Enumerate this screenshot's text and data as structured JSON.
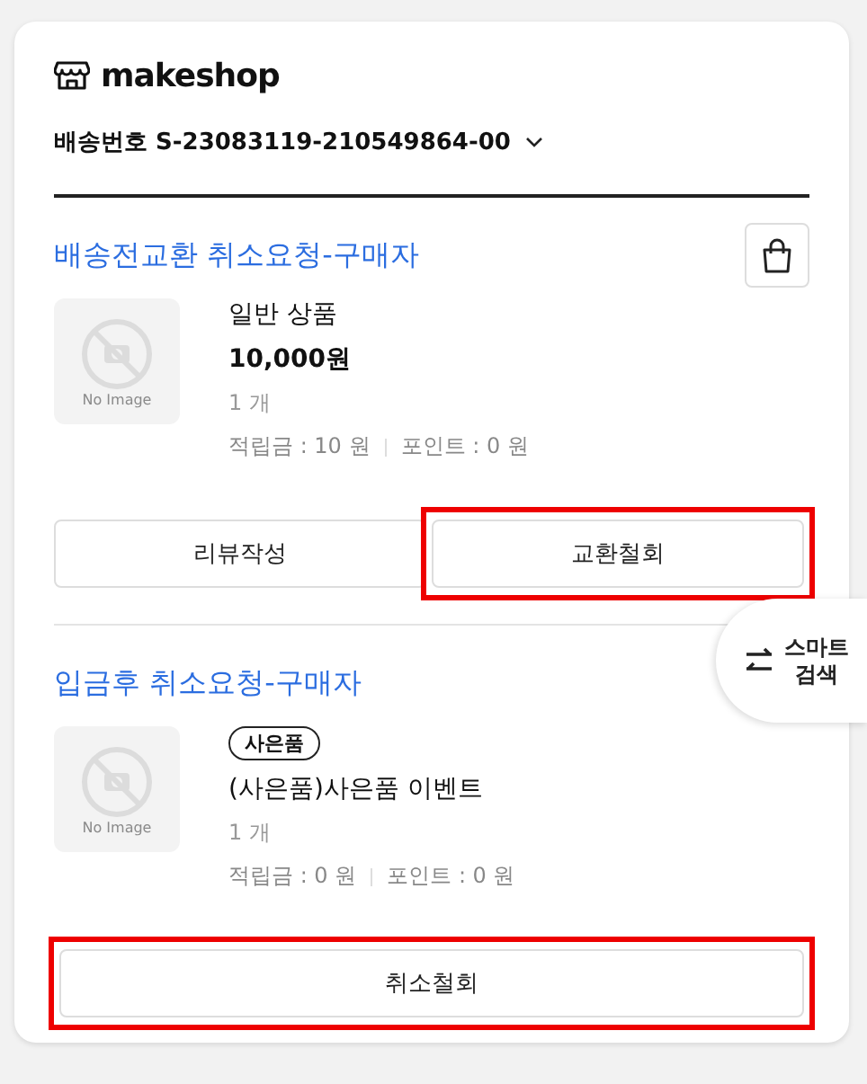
{
  "brand": {
    "name": "makeshop"
  },
  "shipment": {
    "label": "배송번호",
    "number": "S-23083119-210549864-00"
  },
  "orders": [
    {
      "status": "배송전교환 취소요청-구매자",
      "bag_button": true,
      "item": {
        "thumbnail_text": "No Image",
        "name": "일반 상품",
        "price": "10,000원",
        "quantity": "1 개",
        "reserve": "적립금 : 10 원",
        "points": "포인트 : 0 원"
      },
      "buttons": [
        {
          "label": "리뷰작성",
          "highlighted": false
        },
        {
          "label": "교환철회",
          "highlighted": true
        }
      ]
    },
    {
      "status": "입금후 취소요청-구매자",
      "item": {
        "badge": "사은품",
        "thumbnail_text": "No Image",
        "name": "(사은품)사은품 이벤트",
        "quantity": "1 개",
        "reserve": "적립금 : 0 원",
        "points": "포인트 : 0 원"
      },
      "buttons": [
        {
          "label": "취소철회",
          "highlighted": true
        }
      ]
    }
  ],
  "smart_search": {
    "label": "스마트 검색"
  }
}
